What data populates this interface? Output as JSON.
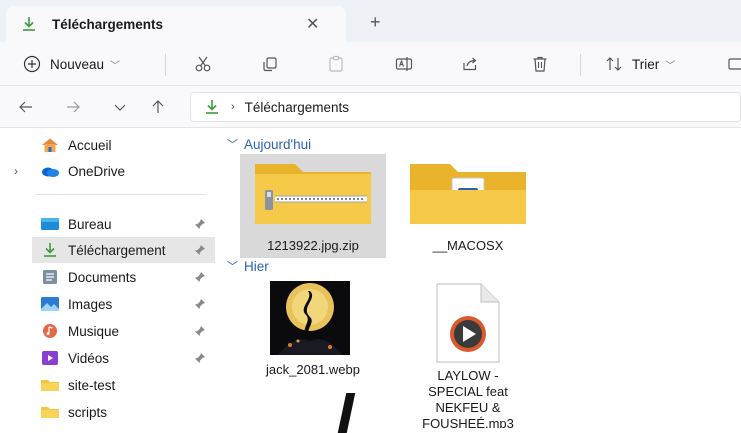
{
  "tab": {
    "title": "Téléchargements",
    "close_symbol": "✕",
    "new_tab_symbol": "+"
  },
  "toolbar": {
    "new_label": "Nouveau",
    "sort_label": "Trier",
    "icons": [
      "plus-circle-icon",
      "cut-icon",
      "copy-icon",
      "paste-icon",
      "rename-icon",
      "share-icon",
      "delete-icon",
      "sort-icon"
    ]
  },
  "address": {
    "path": "Téléchargements",
    "separator": "›"
  },
  "sidebar": {
    "items": [
      {
        "label": "Accueil",
        "icon": "home-icon"
      },
      {
        "label": "OneDrive",
        "icon": "cloud-icon"
      },
      {
        "label": "Bureau",
        "icon": "desktop-icon"
      },
      {
        "label": "Téléchargement",
        "icon": "download-icon"
      },
      {
        "label": "Documents",
        "icon": "documents-icon"
      },
      {
        "label": "Images",
        "icon": "images-icon"
      },
      {
        "label": "Musique",
        "icon": "music-icon"
      },
      {
        "label": "Vidéos",
        "icon": "videos-icon"
      },
      {
        "label": "site-test",
        "icon": "folder-icon"
      },
      {
        "label": "scripts",
        "icon": "folder-icon"
      }
    ]
  },
  "groups": [
    {
      "label": "Aujourd'hui"
    },
    {
      "label": "Hier"
    }
  ],
  "files": [
    {
      "name": "1213922.jpg.zip",
      "type": "zip-folder"
    },
    {
      "name": "__MACOSX",
      "type": "folder"
    },
    {
      "name": "jack_2081.webp",
      "type": "image"
    },
    {
      "name_lines": [
        "LAYLOW -",
        "SPECIAL feat",
        "NEKFEU &",
        "FOUSHEÉ.mp3"
      ],
      "type": "audio"
    }
  ],
  "colors": {
    "accent": "#2b61b8",
    "folder": "#f5c542",
    "download_green": "#3c9a3c"
  }
}
